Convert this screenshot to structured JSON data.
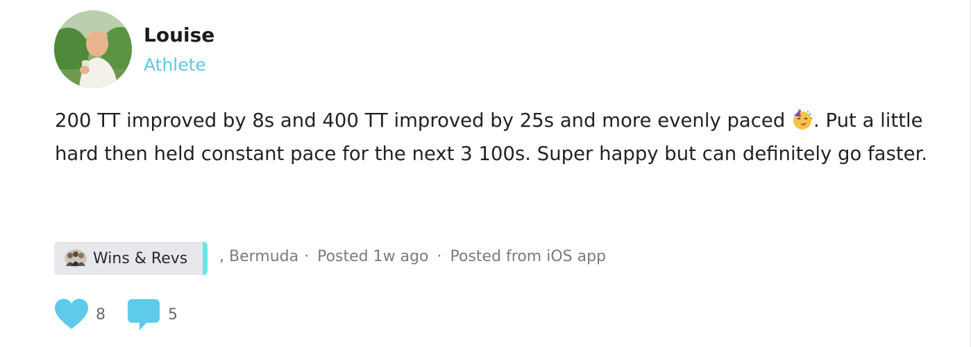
{
  "author": {
    "name": "Louise",
    "role": "Athlete",
    "avatar_icon": "user-photo-avatar"
  },
  "post": {
    "text_part1": "200 TT improved by 8s and 400 TT improved by 25s and more evenly paced ",
    "emoji_icon": "partying-face-emoji",
    "text_part2": ". Put a little hard then held constant pace for the next 3 100s. Super happy but can definitely go faster."
  },
  "tag": {
    "label": "Wins & Revs",
    "icon": "group-photo-icon",
    "accent_color": "#6ee3e3"
  },
  "meta": {
    "location": ", Bermuda",
    "separator": "·",
    "posted_time": "Posted 1w ago",
    "posted_source": "Posted from iOS app"
  },
  "actions": {
    "like_icon": "heart-icon",
    "like_count": "8",
    "comment_icon": "comment-bubble-icon",
    "comment_count": "5",
    "icon_color": "#5dcbe9"
  },
  "colors": {
    "accent": "#5cc9e8",
    "text": "#222222",
    "meta_text": "#7a7a7a",
    "chip_bg": "#e7e8eb"
  }
}
